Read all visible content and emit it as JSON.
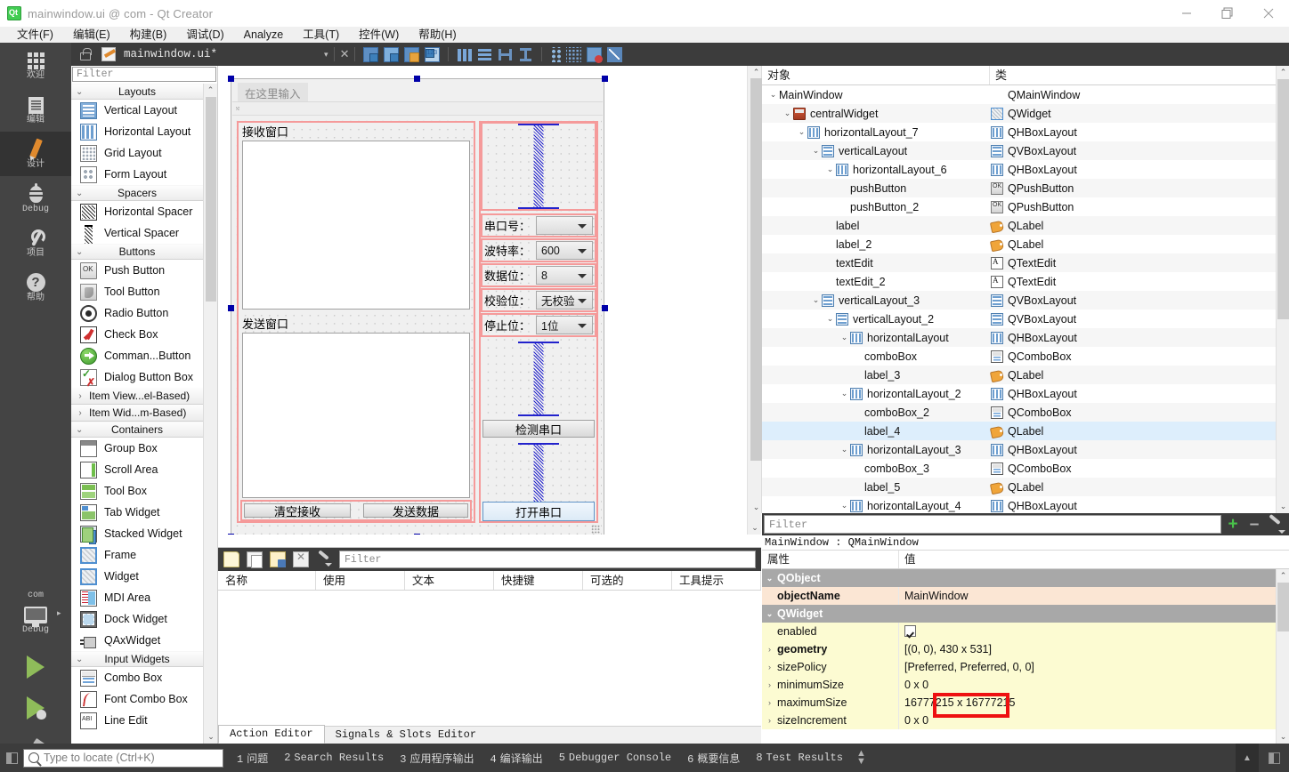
{
  "window": {
    "title": "mainwindow.ui @ com - Qt Creator",
    "icon": "qt-logo-icon",
    "minimize": "—",
    "maximize": "❐",
    "close": "✕"
  },
  "menubar": {
    "items": [
      {
        "label": "文件(F)"
      },
      {
        "label": "编辑(E)"
      },
      {
        "label": "构建(B)"
      },
      {
        "label": "调试(D)"
      },
      {
        "label": "Analyze"
      },
      {
        "label": "工具(T)"
      },
      {
        "label": "控件(W)"
      },
      {
        "label": "帮助(H)"
      }
    ]
  },
  "modebar": {
    "items": [
      {
        "label": "欢迎",
        "icon": "grid-icon",
        "active": false
      },
      {
        "label": "编辑",
        "icon": "document-icon",
        "active": false
      },
      {
        "label": "设计",
        "icon": "pencil-icon",
        "active": true
      },
      {
        "label": "Debug",
        "icon": "bug-icon",
        "active": false
      },
      {
        "label": "项目",
        "icon": "wrench-icon",
        "active": false
      },
      {
        "label": "帮助",
        "icon": "question-icon",
        "active": false
      }
    ],
    "kit": {
      "project_label": "com",
      "build_config": "Debug",
      "icon": "monitor-icon"
    },
    "run_icon": "run-triangle-icon",
    "debug_icon": "run-debug-icon",
    "build_icon": "hammer-icon"
  },
  "toolbar": {
    "lock_icon": "unlocked-icon",
    "file_icon": "ui-file-icon",
    "filename": "mainwindow.ui*",
    "dropdown_icon": "chevron-down-icon",
    "close_icon": "close-icon",
    "buttons": [
      {
        "name": "edit-widgets-icon"
      },
      {
        "name": "edit-signals-slots-icon"
      },
      {
        "name": "edit-buddies-icon"
      },
      {
        "name": "edit-tab-order-icon"
      },
      {
        "name": "layout-horizontally-icon"
      },
      {
        "name": "layout-vertically-icon"
      },
      {
        "name": "layout-splitter-horizontal-icon"
      },
      {
        "name": "layout-splitter-vertical-icon"
      },
      {
        "name": "layout-form-icon"
      },
      {
        "name": "layout-grid-icon"
      },
      {
        "name": "break-layout-icon"
      },
      {
        "name": "adjust-size-icon"
      }
    ]
  },
  "widgetbox": {
    "filter_placeholder": "Filter",
    "groups": [
      {
        "title": "Layouts",
        "expanded": true,
        "chevron": "⌄",
        "items": [
          {
            "label": "Vertical Layout",
            "icon": "vertical-layout-icon"
          },
          {
            "label": "Horizontal Layout",
            "icon": "horizontal-layout-icon"
          },
          {
            "label": "Grid Layout",
            "icon": "grid-layout-icon"
          },
          {
            "label": "Form Layout",
            "icon": "form-layout-icon"
          }
        ]
      },
      {
        "title": "Spacers",
        "expanded": true,
        "chevron": "⌄",
        "items": [
          {
            "label": "Horizontal Spacer",
            "icon": "horizontal-spacer-icon"
          },
          {
            "label": "Vertical Spacer",
            "icon": "vertical-spacer-icon"
          }
        ]
      },
      {
        "title": "Buttons",
        "expanded": true,
        "chevron": "⌄",
        "items": [
          {
            "label": "Push Button",
            "icon": "push-button-icon"
          },
          {
            "label": "Tool Button",
            "icon": "tool-button-icon"
          },
          {
            "label": "Radio Button",
            "icon": "radio-button-icon"
          },
          {
            "label": "Check Box",
            "icon": "check-box-icon"
          },
          {
            "label": "Comman...Button",
            "icon": "command-link-button-icon"
          },
          {
            "label": "Dialog Button Box",
            "icon": "dialog-button-box-icon"
          }
        ]
      }
    ],
    "collapsed": [
      {
        "label": "Item View...el-Based)",
        "chevron": "›"
      },
      {
        "label": "Item Wid...m-Based)",
        "chevron": "›"
      }
    ],
    "containers": {
      "title": "Containers",
      "chevron": "⌄",
      "items": [
        {
          "label": "Group Box",
          "icon": "group-box-icon"
        },
        {
          "label": "Scroll Area",
          "icon": "scroll-area-icon"
        },
        {
          "label": "Tool Box",
          "icon": "tool-box-icon"
        },
        {
          "label": "Tab Widget",
          "icon": "tab-widget-icon"
        },
        {
          "label": "Stacked Widget",
          "icon": "stacked-widget-icon"
        },
        {
          "label": "Frame",
          "icon": "frame-icon"
        },
        {
          "label": "Widget",
          "icon": "widget-icon"
        },
        {
          "label": "MDI Area",
          "icon": "mdi-area-icon"
        },
        {
          "label": "Dock Widget",
          "icon": "dock-widget-icon"
        },
        {
          "label": "QAxWidget",
          "icon": "qax-widget-icon"
        }
      ]
    },
    "inputwidgets": {
      "title": "Input Widgets",
      "chevron": "⌄",
      "items": [
        {
          "label": "Combo Box",
          "icon": "combo-box-icon"
        },
        {
          "label": "Font Combo Box",
          "icon": "font-combo-box-icon"
        },
        {
          "label": "Line Edit",
          "icon": "line-edit-icon"
        }
      ]
    }
  },
  "designer": {
    "menu_placeholder": "在这里输入",
    "recv_label": "接收窗口",
    "send_label": "发送窗口",
    "combos": [
      {
        "label": "串口号：",
        "value": ""
      },
      {
        "label": "波特率：",
        "value": "600"
      },
      {
        "label": "数据位：",
        "value": "8"
      },
      {
        "label": "校验位：",
        "value": "无校验"
      },
      {
        "label": "停止位：",
        "value": "1位"
      }
    ],
    "buttons": [
      {
        "label": "清空接收",
        "primary": false
      },
      {
        "label": "发送数据",
        "primary": false
      },
      {
        "label": "检测串口",
        "primary": false
      },
      {
        "label": "打开串口",
        "primary": true
      }
    ]
  },
  "objectpane": {
    "columns": {
      "name": "对象",
      "class": "类"
    },
    "rows": [
      {
        "indent": 0,
        "chevron": "⌄",
        "name": "MainWindow",
        "icon": "",
        "class": "QMainWindow",
        "class_icon": "",
        "selected": false
      },
      {
        "indent": 1,
        "chevron": "⌄",
        "name": "centralWidget",
        "icon": "central-widget-icon",
        "class": "QWidget",
        "class_icon": "qwidget-icon",
        "selected": false
      },
      {
        "indent": 2,
        "chevron": "⌄",
        "name": "horizontalLayout_7",
        "icon": "hbox-layout-icon",
        "class": "QHBoxLayout",
        "class_icon": "hbox-layout-icon",
        "selected": false
      },
      {
        "indent": 3,
        "chevron": "⌄",
        "name": "verticalLayout",
        "icon": "vbox-layout-icon",
        "class": "QVBoxLayout",
        "class_icon": "vbox-layout-icon",
        "selected": false
      },
      {
        "indent": 4,
        "chevron": "⌄",
        "name": "horizontalLayout_6",
        "icon": "hbox-layout-icon",
        "class": "QHBoxLayout",
        "class_icon": "hbox-layout-icon",
        "selected": false
      },
      {
        "indent": 5,
        "chevron": "",
        "name": "pushButton",
        "icon": "",
        "class": "QPushButton",
        "class_icon": "push-button-icon",
        "selected": false
      },
      {
        "indent": 5,
        "chevron": "",
        "name": "pushButton_2",
        "icon": "",
        "class": "QPushButton",
        "class_icon": "push-button-icon",
        "selected": false
      },
      {
        "indent": 4,
        "chevron": "",
        "name": "label",
        "icon": "",
        "class": "QLabel",
        "class_icon": "label-icon",
        "selected": false
      },
      {
        "indent": 4,
        "chevron": "",
        "name": "label_2",
        "icon": "",
        "class": "QLabel",
        "class_icon": "label-icon",
        "selected": false
      },
      {
        "indent": 4,
        "chevron": "",
        "name": "textEdit",
        "icon": "",
        "class": "QTextEdit",
        "class_icon": "text-edit-icon",
        "selected": false
      },
      {
        "indent": 4,
        "chevron": "",
        "name": "textEdit_2",
        "icon": "",
        "class": "QTextEdit",
        "class_icon": "text-edit-icon",
        "selected": false
      },
      {
        "indent": 3,
        "chevron": "⌄",
        "name": "verticalLayout_3",
        "icon": "vbox-layout-icon",
        "class": "QVBoxLayout",
        "class_icon": "vbox-layout-icon",
        "selected": false
      },
      {
        "indent": 4,
        "chevron": "⌄",
        "name": "verticalLayout_2",
        "icon": "vbox-layout-icon",
        "class": "QVBoxLayout",
        "class_icon": "vbox-layout-icon",
        "selected": false
      },
      {
        "indent": 5,
        "chevron": "⌄",
        "name": "horizontalLayout",
        "icon": "hbox-layout-icon",
        "class": "QHBoxLayout",
        "class_icon": "hbox-layout-icon",
        "selected": false
      },
      {
        "indent": 6,
        "chevron": "",
        "name": "comboBox",
        "icon": "",
        "class": "QComboBox",
        "class_icon": "combo-box-icon",
        "selected": false
      },
      {
        "indent": 6,
        "chevron": "",
        "name": "label_3",
        "icon": "",
        "class": "QLabel",
        "class_icon": "label-icon",
        "selected": false
      },
      {
        "indent": 5,
        "chevron": "⌄",
        "name": "horizontalLayout_2",
        "icon": "hbox-layout-icon",
        "class": "QHBoxLayout",
        "class_icon": "hbox-layout-icon",
        "selected": false
      },
      {
        "indent": 6,
        "chevron": "",
        "name": "comboBox_2",
        "icon": "",
        "class": "QComboBox",
        "class_icon": "combo-box-icon",
        "selected": false
      },
      {
        "indent": 6,
        "chevron": "",
        "name": "label_4",
        "icon": "",
        "class": "QLabel",
        "class_icon": "label-icon",
        "selected": true
      },
      {
        "indent": 5,
        "chevron": "⌄",
        "name": "horizontalLayout_3",
        "icon": "hbox-layout-icon",
        "class": "QHBoxLayout",
        "class_icon": "hbox-layout-icon",
        "selected": false
      },
      {
        "indent": 6,
        "chevron": "",
        "name": "comboBox_3",
        "icon": "",
        "class": "QComboBox",
        "class_icon": "combo-box-icon",
        "selected": false
      },
      {
        "indent": 6,
        "chevron": "",
        "name": "label_5",
        "icon": "",
        "class": "QLabel",
        "class_icon": "label-icon",
        "selected": false
      },
      {
        "indent": 5,
        "chevron": "⌄",
        "name": "horizontalLayout_4",
        "icon": "hbox-layout-icon",
        "class": "QHBoxLayout",
        "class_icon": "hbox-layout-icon",
        "selected": false
      }
    ]
  },
  "actioneditor": {
    "filter_placeholder": "Filter",
    "toolbar_icons": [
      "new-action-icon",
      "copy-action-icon",
      "edit-action-icon",
      "delete-action-icon",
      "view-options-icon"
    ],
    "columns": [
      "名称",
      "使用",
      "文本",
      "快捷键",
      "可选的",
      "工具提示"
    ],
    "tabs": [
      {
        "label": "Action Editor",
        "active": true
      },
      {
        "label": "Signals & Slots Editor",
        "active": false
      }
    ]
  },
  "propertyeditor": {
    "filter_placeholder": "Filter",
    "add_icon": "plus-icon",
    "remove_icon": "minus-icon",
    "config_icon": "configure-icon",
    "object_line": "MainWindow : QMainWindow",
    "columns": {
      "property": "属性",
      "value": "值"
    },
    "rows": [
      {
        "chevron": "⌄",
        "name": "QObject",
        "value": "",
        "style": "group",
        "bold": true
      },
      {
        "chevron": "",
        "name": "objectName",
        "value": "MainWindow",
        "style": "peach",
        "bold": true
      },
      {
        "chevron": "⌄",
        "name": "QWidget",
        "value": "",
        "style": "group",
        "bold": true
      },
      {
        "chevron": "",
        "name": "enabled",
        "value": "",
        "style": "yellow",
        "bold": false,
        "checkbox": true
      },
      {
        "chevron": "›",
        "name": "geometry",
        "value": "[(0, 0), 430 x 531]",
        "style": "yellow",
        "bold": true,
        "highlight": true
      },
      {
        "chevron": "›",
        "name": "sizePolicy",
        "value": "[Preferred, Preferred, 0, 0]",
        "style": "yellow",
        "bold": false
      },
      {
        "chevron": "›",
        "name": "minimumSize",
        "value": "0 x 0",
        "style": "yellow",
        "bold": false
      },
      {
        "chevron": "›",
        "name": "maximumSize",
        "value": "16777215 x 16777215",
        "style": "yellow",
        "bold": false
      },
      {
        "chevron": "›",
        "name": "sizeIncrement",
        "value": "0 x 0",
        "style": "yellow",
        "bold": false
      }
    ],
    "highlight_text": "430 x 531]",
    "highlight_color": "#ee1111"
  },
  "statusbar": {
    "panel_icon": "sidebar-toggle-icon",
    "locator_placeholder": "Type to locate (Ctrl+K)",
    "search_icon": "search-icon",
    "outputs": [
      {
        "num": "1",
        "label": "问题"
      },
      {
        "num": "2",
        "label": "Search Results"
      },
      {
        "num": "3",
        "label": "应用程序输出"
      },
      {
        "num": "4",
        "label": "编译输出"
      },
      {
        "num": "5",
        "label": "Debugger Console"
      },
      {
        "num": "6",
        "label": "概要信息"
      },
      {
        "num": "8",
        "label": "Test Results"
      }
    ],
    "spinner": "⬍",
    "collapse_icon": "chevron-up-icon",
    "right_panel_icon": "output-pane-icon"
  }
}
